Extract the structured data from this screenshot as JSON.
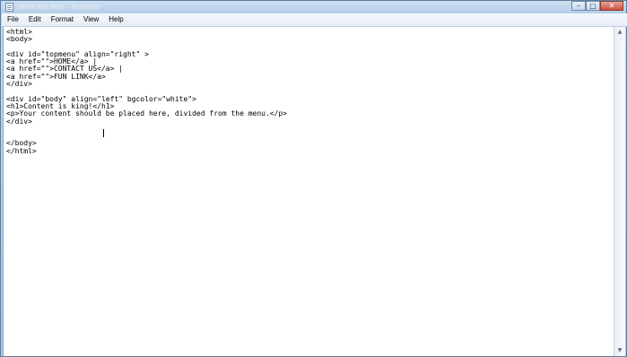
{
  "window": {
    "title": "name-file.html - Notepad",
    "controls": {
      "minimize": "–",
      "maximize": "□",
      "close": "✕"
    }
  },
  "menu": {
    "file": "File",
    "edit": "Edit",
    "format": "Format",
    "view": "View",
    "help": "Help"
  },
  "editor": {
    "lines": [
      "<html>",
      "<body>",
      "",
      "<div id=\"topmenu\" align=\"right\" >",
      "<a href=\"\">HOME</a> |",
      "<a href=\"\">CONTACT US</a> |",
      "<a href=\"\">FUN LINK</a>",
      "</div>",
      "",
      "<div id=\"body\" align=\"left\" bgcolor=\"white\">",
      "<h1>Content is king!</h1>",
      "<p>Your content should be placed here, divided from the menu.</p>",
      "</div>",
      "",
      "",
      "</body>",
      "</html>"
    ]
  },
  "scrollbar": {
    "up_icon": "▲",
    "down_icon": "▼"
  },
  "colors": {
    "titlebar": "#b5cde6",
    "close_button": "#c9503c",
    "editor_background": "#ffffff"
  }
}
